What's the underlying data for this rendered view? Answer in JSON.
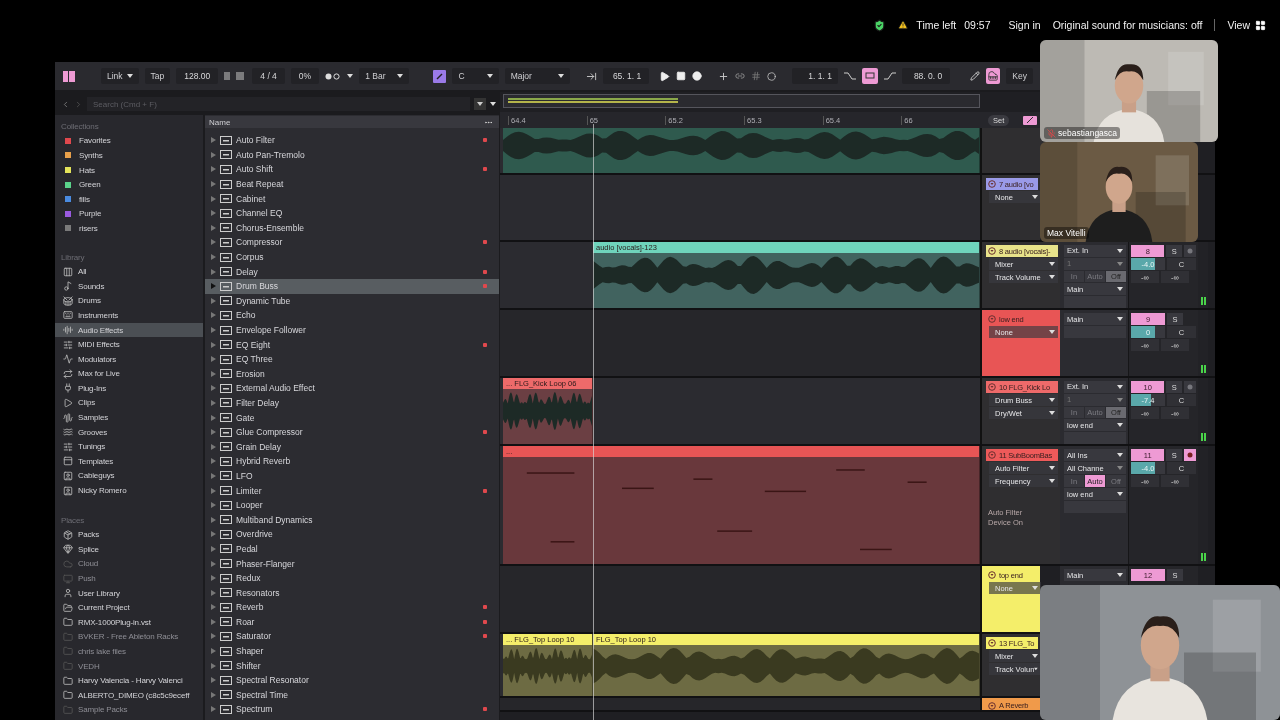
{
  "status": {
    "time_left_label": "Time left",
    "time_left": "09:57",
    "sign_in": "Sign in",
    "sound_setting": "Original sound for musicians: off",
    "view": "View"
  },
  "toolbar": {
    "link": "Link",
    "tap": "Tap",
    "tempo": "128.00",
    "signature": "4 / 4",
    "groove": "0%",
    "quantize": "1 Bar",
    "key": "C",
    "scale": "Major",
    "position": "65. 1. 1",
    "loop_start": "1. 1. 1",
    "loop_length": "88. 0. 0",
    "key_button": "Key",
    "loop_on": true,
    "key_map_on": true
  },
  "browser": {
    "search_placeholder": "Search (Cmd + F)",
    "collections_title": "Collections",
    "collections": [
      {
        "label": "Favorites",
        "color": "#e0484d"
      },
      {
        "label": "Synths",
        "color": "#e8a04a"
      },
      {
        "label": "Hats",
        "color": "#e4e45a"
      },
      {
        "label": "Green",
        "color": "#5ad38a"
      },
      {
        "label": "fills",
        "color": "#4a8be0"
      },
      {
        "label": "Purple",
        "color": "#9a5ae0"
      },
      {
        "label": "risers",
        "color": "#7a7a7a"
      }
    ],
    "library_title": "Library",
    "library": [
      {
        "label": "All",
        "selected": false
      },
      {
        "label": "Sounds",
        "selected": false
      },
      {
        "label": "Drums",
        "selected": false
      },
      {
        "label": "Instruments",
        "selected": false
      },
      {
        "label": "Audio Effects",
        "selected": true
      },
      {
        "label": "MIDI Effects",
        "selected": false
      },
      {
        "label": "Modulators",
        "selected": false
      },
      {
        "label": "Max for Live",
        "selected": false
      },
      {
        "label": "Plug-Ins",
        "selected": false
      },
      {
        "label": "Clips",
        "selected": false
      },
      {
        "label": "Samples",
        "selected": false
      },
      {
        "label": "Grooves",
        "selected": false
      },
      {
        "label": "Tunings",
        "selected": false
      },
      {
        "label": "Templates",
        "selected": false
      },
      {
        "label": "Cableguys",
        "selected": false
      },
      {
        "label": "Nicky Romero",
        "selected": false
      }
    ],
    "places_title": "Places",
    "places": [
      {
        "label": "Packs",
        "disabled": false
      },
      {
        "label": "Splice",
        "disabled": false
      },
      {
        "label": "Cloud",
        "disabled": true
      },
      {
        "label": "Push",
        "disabled": true
      },
      {
        "label": "User Library",
        "disabled": false
      },
      {
        "label": "Current Project",
        "disabled": false
      },
      {
        "label": "RMX-1000Plug-in.vst",
        "disabled": false
      },
      {
        "label": "BVKER - Free Ableton Racks",
        "disabled": true
      },
      {
        "label": "chris lake files",
        "disabled": true
      },
      {
        "label": "VEDH",
        "disabled": true
      },
      {
        "label": "Harvy Valencia - Harvy Valenci",
        "disabled": false
      },
      {
        "label": "ALBERTO_DIMEO (c8c5c9eceff",
        "disabled": false
      },
      {
        "label": "Sample Packs",
        "disabled": true
      }
    ],
    "column_header": "Name",
    "devices": [
      {
        "label": "Auto Filter",
        "marked": true,
        "selected": false
      },
      {
        "label": "Auto Pan-Tremolo",
        "marked": false,
        "selected": false
      },
      {
        "label": "Auto Shift",
        "marked": true,
        "selected": false
      },
      {
        "label": "Beat Repeat",
        "marked": false,
        "selected": false
      },
      {
        "label": "Cabinet",
        "marked": false,
        "selected": false
      },
      {
        "label": "Channel EQ",
        "marked": false,
        "selected": false
      },
      {
        "label": "Chorus-Ensemble",
        "marked": false,
        "selected": false
      },
      {
        "label": "Compressor",
        "marked": true,
        "selected": false
      },
      {
        "label": "Corpus",
        "marked": false,
        "selected": false
      },
      {
        "label": "Delay",
        "marked": true,
        "selected": false
      },
      {
        "label": "Drum Buss",
        "marked": true,
        "selected": true
      },
      {
        "label": "Dynamic Tube",
        "marked": false,
        "selected": false
      },
      {
        "label": "Echo",
        "marked": false,
        "selected": false
      },
      {
        "label": "Envelope Follower",
        "marked": false,
        "selected": false
      },
      {
        "label": "EQ Eight",
        "marked": true,
        "selected": false
      },
      {
        "label": "EQ Three",
        "marked": false,
        "selected": false
      },
      {
        "label": "Erosion",
        "marked": false,
        "selected": false
      },
      {
        "label": "External Audio Effect",
        "marked": false,
        "selected": false
      },
      {
        "label": "Filter Delay",
        "marked": false,
        "selected": false
      },
      {
        "label": "Gate",
        "marked": false,
        "selected": false
      },
      {
        "label": "Glue Compressor",
        "marked": true,
        "selected": false
      },
      {
        "label": "Grain Delay",
        "marked": false,
        "selected": false
      },
      {
        "label": "Hybrid Reverb",
        "marked": false,
        "selected": false
      },
      {
        "label": "LFO",
        "marked": false,
        "selected": false
      },
      {
        "label": "Limiter",
        "marked": true,
        "selected": false
      },
      {
        "label": "Looper",
        "marked": false,
        "selected": false
      },
      {
        "label": "Multiband Dynamics",
        "marked": false,
        "selected": false
      },
      {
        "label": "Overdrive",
        "marked": false,
        "selected": false
      },
      {
        "label": "Pedal",
        "marked": false,
        "selected": false
      },
      {
        "label": "Phaser-Flanger",
        "marked": false,
        "selected": false
      },
      {
        "label": "Redux",
        "marked": false,
        "selected": false
      },
      {
        "label": "Resonators",
        "marked": false,
        "selected": false
      },
      {
        "label": "Reverb",
        "marked": true,
        "selected": false
      },
      {
        "label": "Roar",
        "marked": true,
        "selected": false
      },
      {
        "label": "Saturator",
        "marked": true,
        "selected": false
      },
      {
        "label": "Shaper",
        "marked": false,
        "selected": false
      },
      {
        "label": "Shifter",
        "marked": false,
        "selected": false
      },
      {
        "label": "Spectral Resonator",
        "marked": false,
        "selected": false
      },
      {
        "label": "Spectral Time",
        "marked": false,
        "selected": false
      },
      {
        "label": "Spectrum",
        "marked": true,
        "selected": false
      }
    ]
  },
  "arrangement": {
    "ruler": [
      "64.4",
      "65",
      "65.2",
      "65.3",
      "65.4",
      "66"
    ],
    "set_button": "Set",
    "tracks": [
      {
        "kind": "audio",
        "clips": [
          {
            "kind": "audio",
            "color": "#2f5a4e"
          }
        ]
      },
      {
        "kind": "audio",
        "name": "7 audio [vo",
        "color": "#9a9ae8",
        "choosers": [
          "None"
        ]
      },
      {
        "kind": "audio",
        "name": "8 audio [vocals]-",
        "color": "#e8e38a",
        "choosers": [
          "Mixer",
          "Track Volume"
        ],
        "input": "Ext. In",
        "channel": "1",
        "monitor": [
          {
            "label": "In",
            "selected": false
          },
          {
            "label": "Auto",
            "selected": false
          },
          {
            "label": "Off",
            "selected": true
          }
        ],
        "output": "Main",
        "number": "8",
        "solo": "S",
        "armed": false,
        "volume": "-4.0",
        "level": 0.72,
        "pan": "C",
        "peaks": [
          "-∞",
          "-∞"
        ],
        "clips": [
          {
            "kind": "audio",
            "name": "audio [vocals]-123",
            "color": "#6fd4bc"
          }
        ]
      },
      {
        "kind": "group",
        "name": "low end",
        "color": "#e85555",
        "choosers": [
          "None"
        ],
        "output": "Main",
        "number": "9",
        "solo": "S",
        "volume": "0",
        "level": 0.7,
        "pan": "C",
        "peaks": [
          "-∞",
          "-∞"
        ]
      },
      {
        "kind": "audio",
        "name": "10 FLG_Kick Lo",
        "color": "#ee6a6a",
        "choosers": [
          "Drum Buss",
          "Dry/Wet"
        ],
        "input": "Ext. In",
        "channel": "1",
        "monitor": [
          {
            "label": "In",
            "selected": false
          },
          {
            "label": "Auto",
            "selected": false
          },
          {
            "label": "Off",
            "selected": true
          }
        ],
        "output": "low end",
        "number": "10",
        "solo": "S",
        "armed": false,
        "volume": "-7.4",
        "level": 0.6,
        "pan": "C",
        "peaks": [
          "-∞",
          "-∞"
        ],
        "clips": [
          {
            "kind": "audio",
            "name": "... FLG_Kick Loop 06",
            "color": "#ee6a6a"
          }
        ]
      },
      {
        "kind": "audio",
        "name": "11 SubBoomBas",
        "color": "#ee5a5a",
        "choosers": [
          "Auto Filter",
          "Frequency"
        ],
        "input": "All Ins",
        "channel": "All Channe",
        "monitor": [
          {
            "label": "In",
            "selected": false
          },
          {
            "label": "Auto",
            "selected": true
          },
          {
            "label": "Off",
            "selected": false
          }
        ],
        "output": "low end",
        "number": "11",
        "solo": "S",
        "armed": true,
        "volume": "-4.0",
        "level": 0.72,
        "pan": "C",
        "peaks": [
          "-∞",
          "-∞"
        ],
        "notes": [
          "Auto Filter",
          "Device On"
        ],
        "clips": [
          {
            "kind": "midi",
            "name": "...",
            "color": "#e85555"
          }
        ]
      },
      {
        "kind": "group",
        "name": "top end",
        "color": "#f4ee6a",
        "choosers": [
          "None"
        ],
        "output": "Main",
        "number": "12",
        "solo": "S"
      },
      {
        "kind": "audio",
        "name": "13 FLG_To",
        "color": "#f4ee6a",
        "choosers": [
          "Mixer",
          "Track Volun"
        ],
        "clips": [
          {
            "kind": "audio",
            "name": "... FLG_Top Loop 10",
            "color": "#f4ee6a"
          },
          {
            "kind": "audio",
            "name": "FLG_Top Loop 10",
            "color": "#f4ee6a"
          }
        ]
      },
      {
        "kind": "return",
        "name": "A Reverb",
        "color": "#f09a4a"
      }
    ]
  },
  "videos": [
    {
      "kind": "picture",
      "name": "sebastiangasca",
      "muted": true
    },
    {
      "kind": "picture",
      "name": "Max Vitelli",
      "muted": false
    },
    {
      "kind": "picture"
    }
  ]
}
